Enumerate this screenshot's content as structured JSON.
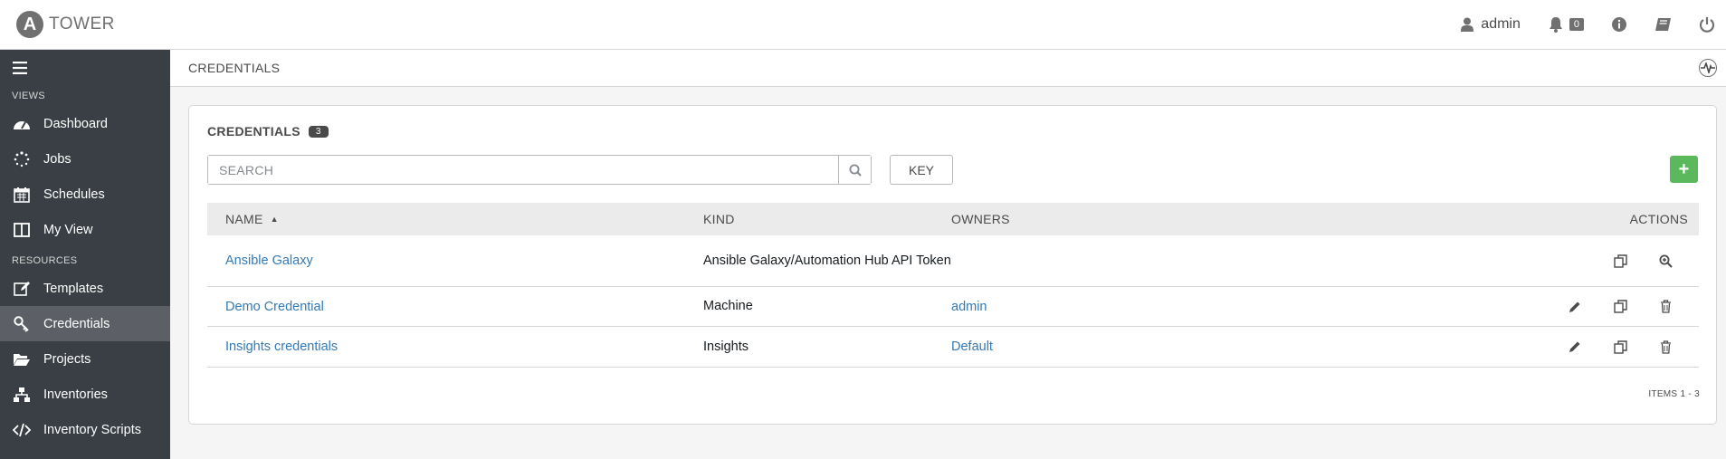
{
  "app": {
    "brand": "TOWER",
    "brand_logo_letter": "A"
  },
  "topbar": {
    "user_label": "admin",
    "notification_count": "0"
  },
  "sidebar": {
    "views_label": "VIEWS",
    "resources_label": "RESOURCES",
    "views": [
      {
        "label": "Dashboard",
        "icon": "dashboard-icon"
      },
      {
        "label": "Jobs",
        "icon": "jobs-spinner-icon"
      },
      {
        "label": "Schedules",
        "icon": "calendar-icon"
      },
      {
        "label": "My View",
        "icon": "columns-icon"
      }
    ],
    "resources": [
      {
        "label": "Templates",
        "icon": "edit-icon"
      },
      {
        "label": "Credentials",
        "icon": "key-icon",
        "active": true
      },
      {
        "label": "Projects",
        "icon": "folder-icon"
      },
      {
        "label": "Inventories",
        "icon": "sitemap-icon"
      },
      {
        "label": "Inventory Scripts",
        "icon": "code-icon"
      }
    ]
  },
  "subheader": {
    "breadcrumb": "CREDENTIALS"
  },
  "panel": {
    "title": "CREDENTIALS",
    "count": "3",
    "search_placeholder": "SEARCH",
    "key_label": "KEY",
    "add_label": "+",
    "items_count": "ITEMS  1 - 3"
  },
  "table": {
    "headers": {
      "name": "NAME",
      "kind": "KIND",
      "owners": "OWNERS",
      "actions": "ACTIONS"
    },
    "rows": [
      {
        "name": "Ansible Galaxy",
        "kind": "Ansible Galaxy/Automation Hub API Token",
        "owners": "",
        "actions": [
          "copy",
          "view"
        ]
      },
      {
        "name": "Demo Credential",
        "kind": "Machine",
        "owners": "admin",
        "actions": [
          "edit",
          "copy",
          "delete"
        ]
      },
      {
        "name": "Insights credentials",
        "kind": "Insights",
        "owners": "Default",
        "actions": [
          "edit",
          "copy",
          "delete"
        ]
      }
    ]
  },
  "colors": {
    "sidebar_bg": "#393f44",
    "sidebar_active": "#5c6066",
    "link": "#337ab7",
    "add_button": "#5cb85c"
  }
}
